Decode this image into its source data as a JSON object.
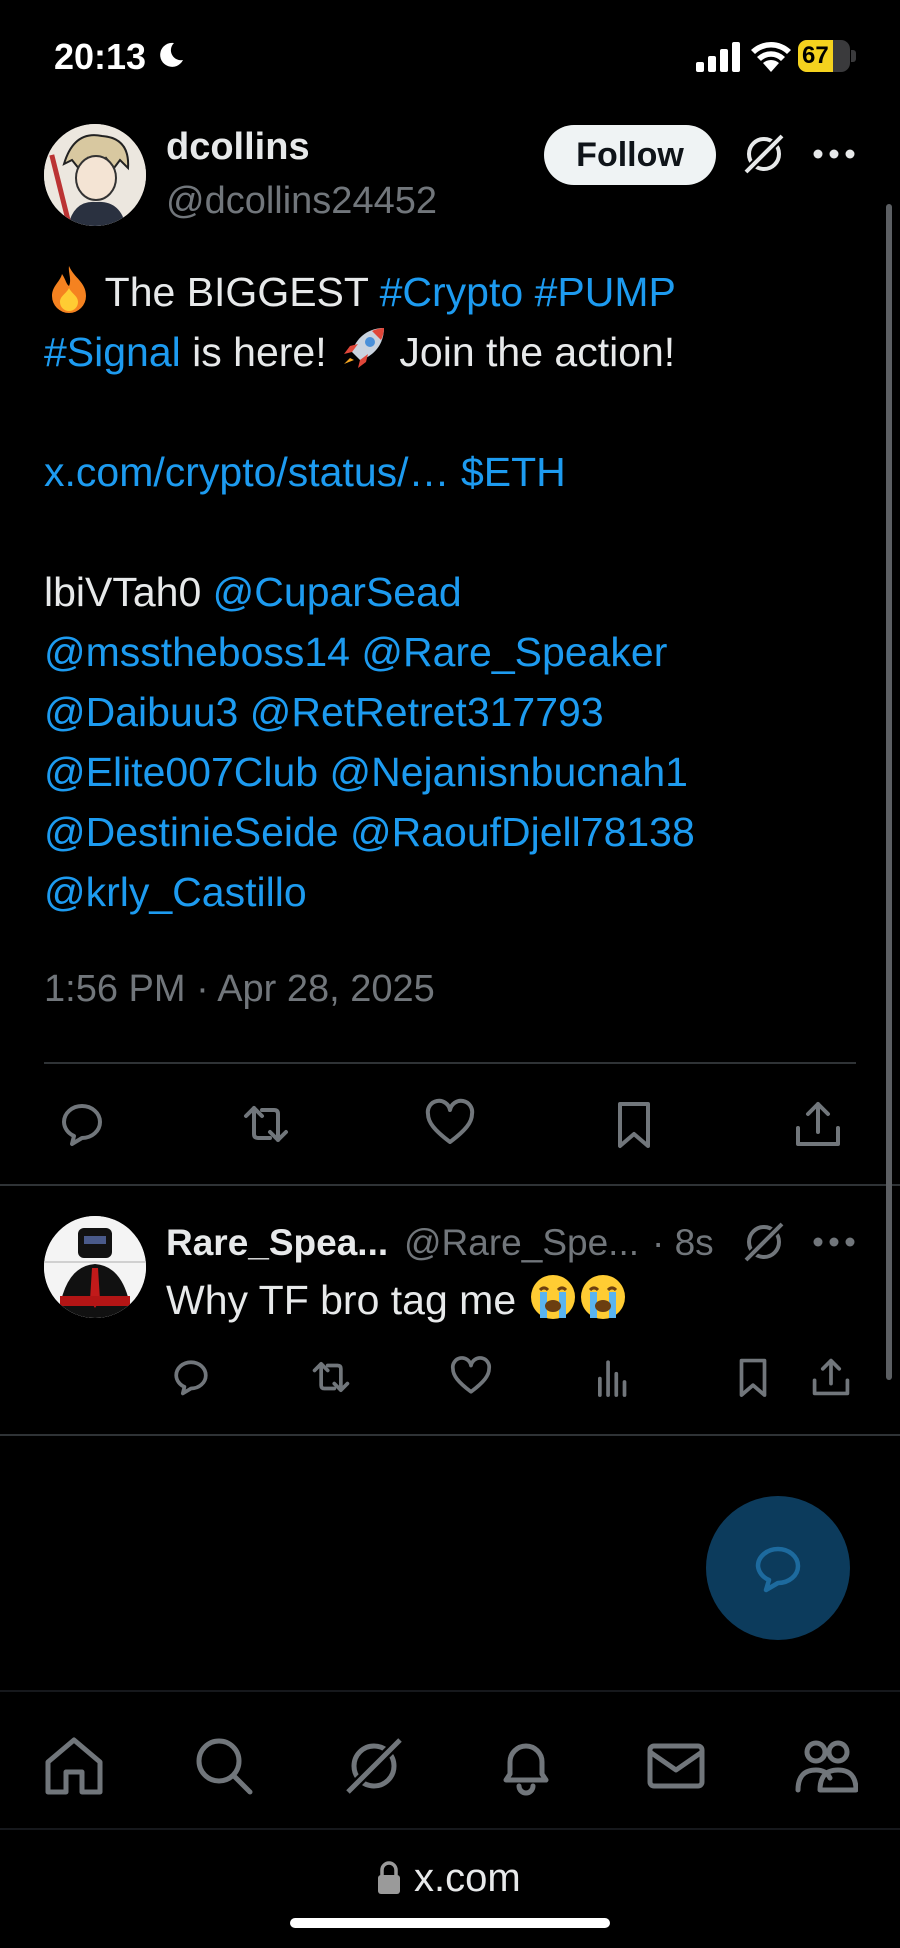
{
  "status_bar": {
    "time": "20:13",
    "battery_percent": "67",
    "battery_level": 0.67
  },
  "post": {
    "author_name": "dcollins",
    "author_handle": "@dcollins24452",
    "follow_label": "Follow",
    "body": {
      "line1_text": " The BIGGEST ",
      "line1_tag1": "#Crypto",
      "line1_tag2": " #PUMP",
      "line2_tag": "#Signal",
      "line2_text": " is here! ",
      "line2_tail": " Join the action!",
      "link": "x.com/crypto/status/…",
      "cashtag": " $ETH",
      "code": "lbiVTah0 ",
      "mentions_line1": "@CuparSead",
      "mentions_line2": "@msstheboss14 @Rare_Speaker",
      "mentions_line3": "@Daibuu3 @RetRetret317793",
      "mentions_line4": "@Elite007Club @Nejanisnbucnah1",
      "mentions_line5": "@DestinieSeide @RaoufDjell78138",
      "mentions_line6": "@krly_Castillo"
    },
    "timestamp": "1:56 PM · Apr 28, 2025"
  },
  "reply": {
    "author_name": "Rare_Spea...",
    "author_handle": "@Rare_Spe...",
    "time": "· 8s",
    "text": "Why TF bro tag me "
  },
  "browser": {
    "url": "x.com"
  },
  "icons": {
    "post_actions": [
      "reply-icon",
      "repost-icon",
      "like-icon",
      "bookmark-icon",
      "share-icon"
    ],
    "reply_actions": [
      "reply-icon",
      "repost-icon",
      "like-icon",
      "views-icon",
      "bookmark-icon",
      "share-icon"
    ],
    "nav": [
      "home-icon",
      "search-icon",
      "grok-icon",
      "notifications-icon",
      "messages-icon",
      "communities-icon"
    ]
  },
  "colors": {
    "link": "#1d9bf0",
    "background": "#000000",
    "muted": "#71767b",
    "fab": "#0c3b5c",
    "battery": "#f5d21e"
  }
}
